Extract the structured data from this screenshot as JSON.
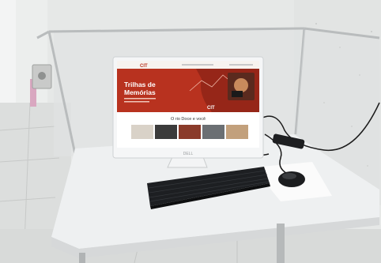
{
  "photo": {
    "description_free": true
  },
  "monitor": {
    "brand": "DELL",
    "screen": {
      "header_logo": "CIT",
      "hero_title_line1": "Trilhas de",
      "hero_title_line2": "Memórias",
      "hero_logo": "CIT",
      "section_heading": "O rio Doce e você"
    }
  },
  "colors": {
    "hero_red": "#b8321f",
    "hero_dark": "#7a1d12",
    "wall": "#e9ebea",
    "desk": "#f1f2f3",
    "keyboard": "#1d1f22"
  }
}
